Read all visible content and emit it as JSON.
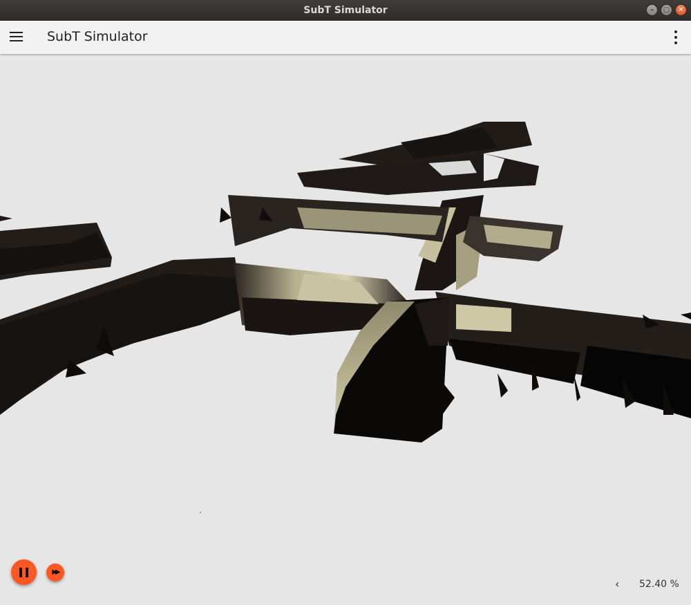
{
  "window": {
    "title": "SubT Simulator",
    "controls": {
      "minimize_icon": "minimize-icon",
      "maximize_icon": "maximize-icon",
      "close_icon": "close-icon"
    }
  },
  "toolbar": {
    "menu_icon": "hamburger-menu-icon",
    "title": "SubT Simulator",
    "overflow_icon": "kebab-menu-icon"
  },
  "playback": {
    "pause_icon": "pause-icon",
    "step_icon": "fast-forward-icon",
    "rtf_toggle_icon": "chevron-left-icon",
    "real_time_factor": "52.40 %"
  },
  "colors": {
    "accent": "#ff5722",
    "toolbar_bg": "#f2f2f2",
    "scene_bg": "#e6e6e6",
    "tunnel_dark": "#1c1715",
    "tunnel_lit": "#c9c3a3"
  }
}
